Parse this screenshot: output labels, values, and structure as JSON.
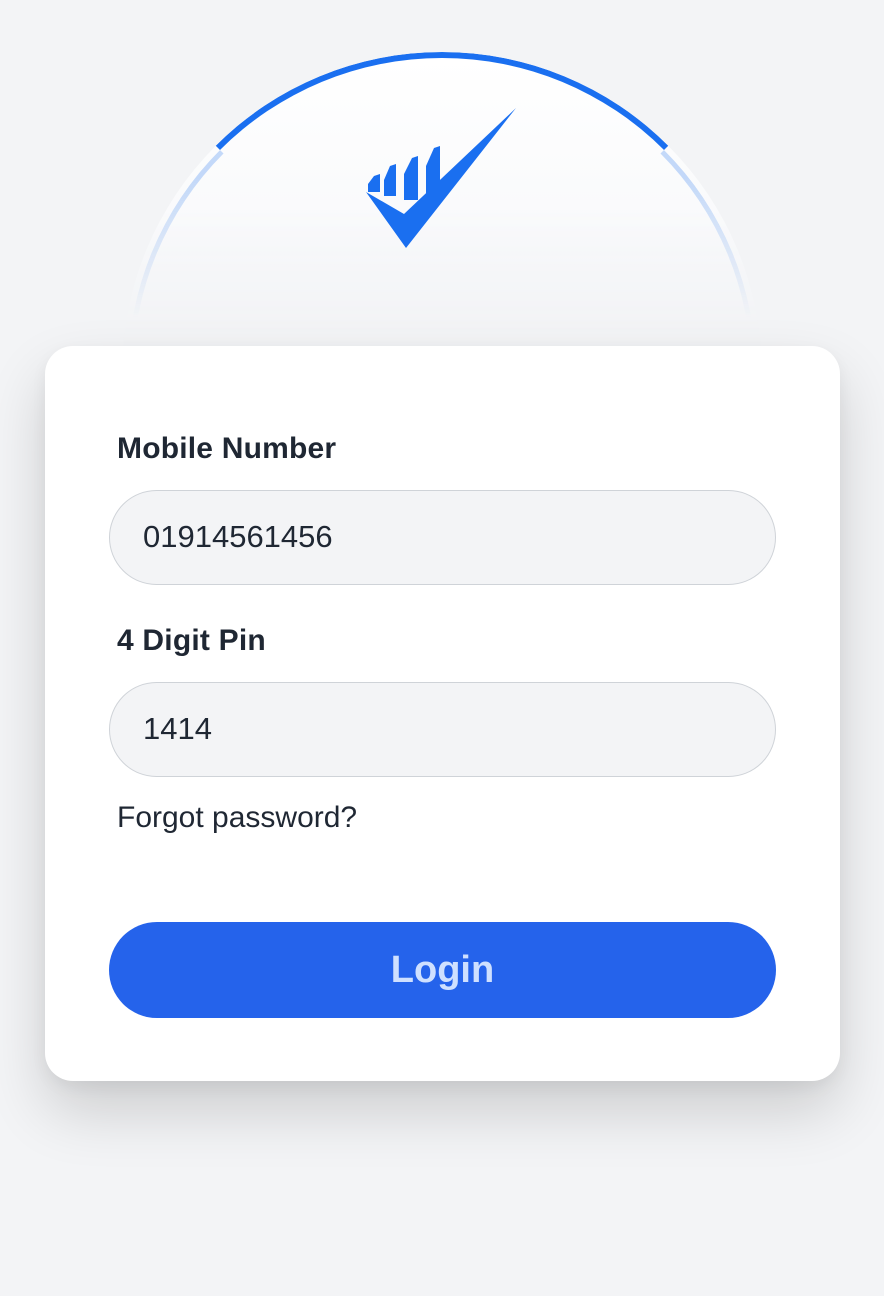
{
  "branding": {
    "logo_icon": "checkmark-bars-logo",
    "accent_color": "#1a6ff0"
  },
  "form": {
    "mobile": {
      "label": "Mobile Number",
      "value": "01914561456"
    },
    "pin": {
      "label": "4 Digit Pin",
      "value": "1414"
    },
    "forgot_link": "Forgot password?",
    "login_button": "Login"
  },
  "colors": {
    "background": "#f3f4f6",
    "card": "#ffffff",
    "primary_button": "#2563eb",
    "button_text": "#cfe0ff",
    "text": "#1f2733"
  }
}
